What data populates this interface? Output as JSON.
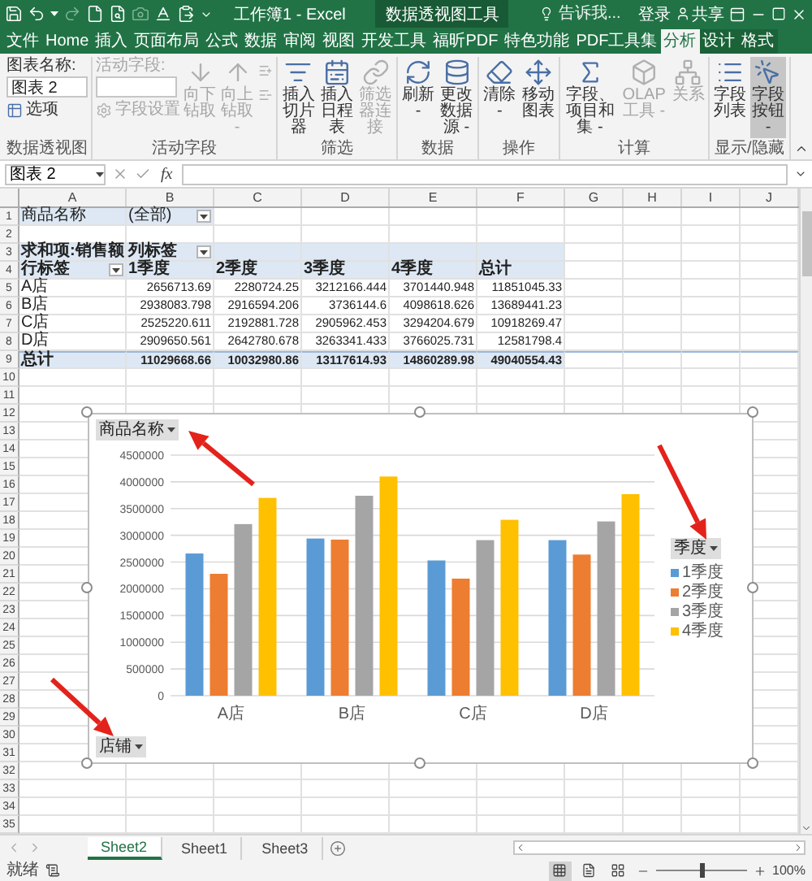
{
  "title_bar": {
    "title": "工作簿1 - Excel",
    "context_title": "数据透视图工具",
    "tell_me": {
      "placeholder": "告诉我..."
    },
    "sign_in": "登录",
    "share": "共享"
  },
  "tabs": [
    {
      "label": "文件",
      "selected": false,
      "contextual": false
    },
    {
      "label": "Home",
      "selected": false,
      "contextual": false
    },
    {
      "label": "插入",
      "selected": false,
      "contextual": false
    },
    {
      "label": "页面布局",
      "selected": false,
      "contextual": false
    },
    {
      "label": "公式",
      "selected": false,
      "contextual": false
    },
    {
      "label": "数据",
      "selected": false,
      "contextual": false
    },
    {
      "label": "审阅",
      "selected": false,
      "contextual": false
    },
    {
      "label": "视图",
      "selected": false,
      "contextual": false
    },
    {
      "label": "开发工具",
      "selected": false,
      "contextual": false
    },
    {
      "label": "福昕PDF",
      "selected": false,
      "contextual": false
    },
    {
      "label": "特色功能",
      "selected": false,
      "contextual": false
    },
    {
      "label": "PDF工具集",
      "selected": false,
      "contextual": false
    },
    {
      "label": "分析",
      "selected": true,
      "contextual": true
    },
    {
      "label": "设计",
      "selected": false,
      "contextual": true
    },
    {
      "label": "格式",
      "selected": false,
      "contextual": true
    }
  ],
  "ribbon_groups": [
    {
      "title": "数据透视图",
      "items": [
        {
          "kind": "field",
          "label": "图表名称:",
          "value": "图表 2",
          "disabled": false,
          "on": false
        },
        {
          "kind": "small",
          "label": "选项",
          "disabled": false,
          "on": false
        }
      ]
    },
    {
      "title": "活动字段",
      "items": [
        {
          "kind": "field",
          "label": "活动字段:",
          "disabled": true,
          "on": false
        },
        {
          "kind": "small",
          "label": "字段设置",
          "disabled": true,
          "on": false
        },
        {
          "kind": "large",
          "label": "向下钻取",
          "disabled": true,
          "on": false
        },
        {
          "kind": "large",
          "label": "向上钻取 -",
          "disabled": true,
          "on": false
        },
        {
          "kind": "mini",
          "disabled": true,
          "on": false
        }
      ]
    },
    {
      "title": "筛选",
      "items": [
        {
          "kind": "large",
          "label": "插入切片器",
          "disabled": false,
          "on": false
        },
        {
          "kind": "large",
          "label": "插入日程表",
          "disabled": false,
          "on": false
        },
        {
          "kind": "large",
          "label": "筛选器连接",
          "disabled": true,
          "on": false
        }
      ]
    },
    {
      "title": "数据",
      "items": [
        {
          "kind": "large",
          "label": "刷新 -",
          "disabled": false,
          "on": false
        },
        {
          "kind": "large",
          "label": "更改数据源 -",
          "disabled": false,
          "on": false
        }
      ]
    },
    {
      "title": "操作",
      "items": [
        {
          "kind": "large",
          "label": "清除 -",
          "disabled": false,
          "on": false
        },
        {
          "kind": "large",
          "label": "移动图表",
          "disabled": false,
          "on": false
        }
      ]
    },
    {
      "title": "计算",
      "items": [
        {
          "kind": "large",
          "label": "字段、项目和集 -",
          "disabled": false,
          "on": false
        },
        {
          "kind": "large",
          "label": "OLAP 工具 -",
          "disabled": true,
          "on": false
        },
        {
          "kind": "large",
          "label": "关系",
          "disabled": true,
          "on": false
        }
      ]
    },
    {
      "title": "显示/隐藏",
      "items": [
        {
          "kind": "large",
          "label": "字段列表",
          "disabled": false,
          "on": false
        },
        {
          "kind": "large",
          "label": "字段按钮 -",
          "disabled": false,
          "on": true
        }
      ]
    }
  ],
  "formula_bar": {
    "name_box": "图表 2",
    "insert_function": "fx"
  },
  "columns": [
    "A",
    "B",
    "C",
    "D",
    "E",
    "F",
    "G",
    "H",
    "I",
    "J"
  ],
  "rows": [
    {
      "number": "1",
      "kind": "filter",
      "cells": [
        {
          "kind": "text",
          "text": "商品名称"
        },
        {
          "kind": "text_dropdown",
          "text": "(全部)"
        }
      ]
    },
    {
      "number": "2"
    },
    {
      "number": "3",
      "kind": "header",
      "cells": [
        {
          "kind": "text",
          "text": "求和项:销售额"
        },
        {
          "kind": "text_dropdown",
          "text": "列标签"
        }
      ]
    },
    {
      "number": "4",
      "kind": "header",
      "cells": [
        {
          "kind": "text_dropdown",
          "text": "行标签"
        },
        {
          "kind": "text",
          "text": "1季度"
        },
        {
          "kind": "text",
          "text": "2季度"
        },
        {
          "kind": "text",
          "text": "3季度"
        },
        {
          "kind": "text",
          "text": "4季度"
        },
        {
          "kind": "text",
          "text": "总计"
        }
      ]
    },
    {
      "number": "5",
      "kind": "body",
      "cells": [
        {
          "kind": "text",
          "text": "A店"
        },
        {
          "kind": "text",
          "text": "2656713.69"
        },
        {
          "kind": "text",
          "text": "2280724.25"
        },
        {
          "kind": "text",
          "text": "3212166.444"
        },
        {
          "kind": "text",
          "text": "3701440.948"
        },
        {
          "kind": "text",
          "text": "11851045.33"
        }
      ]
    },
    {
      "number": "6",
      "kind": "body",
      "cells": [
        {
          "kind": "text",
          "text": "B店"
        },
        {
          "kind": "text",
          "text": "2938083.798"
        },
        {
          "kind": "text",
          "text": "2916594.206"
        },
        {
          "kind": "text",
          "text": "3736144.6"
        },
        {
          "kind": "text",
          "text": "4098618.626"
        },
        {
          "kind": "text",
          "text": "13689441.23"
        }
      ]
    },
    {
      "number": "7",
      "kind": "body",
      "cells": [
        {
          "kind": "text",
          "text": "C店"
        },
        {
          "kind": "text",
          "text": "2525220.611"
        },
        {
          "kind": "text",
          "text": "2192881.728"
        },
        {
          "kind": "text",
          "text": "2905962.453"
        },
        {
          "kind": "text",
          "text": "3294204.679"
        },
        {
          "kind": "text",
          "text": "10918269.47"
        }
      ]
    },
    {
      "number": "8",
      "kind": "body",
      "cells": [
        {
          "kind": "text",
          "text": "D店"
        },
        {
          "kind": "text",
          "text": "2909650.561"
        },
        {
          "kind": "text",
          "text": "2642780.678"
        },
        {
          "kind": "text",
          "text": "3263341.433"
        },
        {
          "kind": "text",
          "text": "3766025.731"
        },
        {
          "kind": "text",
          "text": "12581798.4"
        }
      ]
    },
    {
      "number": "9",
      "kind": "total",
      "cells": [
        {
          "kind": "text",
          "text": "总计"
        },
        {
          "kind": "text",
          "text": "11029668.66"
        },
        {
          "kind": "text",
          "text": "10032980.86"
        },
        {
          "kind": "text",
          "text": "13117614.93"
        },
        {
          "kind": "text",
          "text": "14860289.98"
        },
        {
          "kind": "text",
          "text": "49040554.43"
        }
      ]
    },
    {
      "number": "10"
    },
    {
      "number": "11"
    },
    {
      "number": "12"
    },
    {
      "number": "13"
    },
    {
      "number": "14"
    },
    {
      "number": "15"
    },
    {
      "number": "16"
    },
    {
      "number": "17"
    },
    {
      "number": "18"
    },
    {
      "number": "19"
    },
    {
      "number": "20"
    },
    {
      "number": "21"
    },
    {
      "number": "22"
    },
    {
      "number": "23"
    },
    {
      "number": "24"
    },
    {
      "number": "25"
    },
    {
      "number": "26"
    },
    {
      "number": "27"
    },
    {
      "number": "28"
    },
    {
      "number": "29"
    },
    {
      "number": "30"
    },
    {
      "number": "31"
    },
    {
      "number": "32"
    },
    {
      "number": "33"
    },
    {
      "number": "34"
    },
    {
      "number": "35"
    }
  ],
  "chart": {
    "filter_button": "商品名称",
    "legend_button": "季度",
    "axis_button": "店铺",
    "chart_data": {
      "type": "bar",
      "categories": [
        "A店",
        "B店",
        "C店",
        "D店"
      ],
      "series": [
        {
          "name": "1季度",
          "color": "#5b9bd5",
          "values": [
            2660000,
            2940000,
            2530000,
            2910000
          ]
        },
        {
          "name": "2季度",
          "color": "#ed7d31",
          "values": [
            2280000,
            2920000,
            2190000,
            2640000
          ]
        },
        {
          "name": "3季度",
          "color": "#a5a5a5",
          "values": [
            3210000,
            3740000,
            2910000,
            3260000
          ]
        },
        {
          "name": "4季度",
          "color": "#ffc000",
          "values": [
            3700000,
            4100000,
            3290000,
            3770000
          ]
        }
      ],
      "grid": true,
      "ylim": [
        0,
        4500000
      ],
      "yticks": [
        0,
        500000,
        1000000,
        1500000,
        2000000,
        2500000,
        3000000,
        3500000,
        4000000,
        4500000
      ]
    }
  },
  "sheet_tabs": [
    {
      "label": "Sheet2",
      "selected": true
    },
    {
      "label": "Sheet1",
      "selected": false
    },
    {
      "label": "Sheet3",
      "selected": false
    }
  ],
  "status_bar": {
    "status": "就绪",
    "views": [
      {
        "selected": true
      },
      {
        "selected": false
      },
      {
        "selected": false
      }
    ],
    "zoom": {
      "level": 0.5,
      "reading": "100%"
    }
  }
}
